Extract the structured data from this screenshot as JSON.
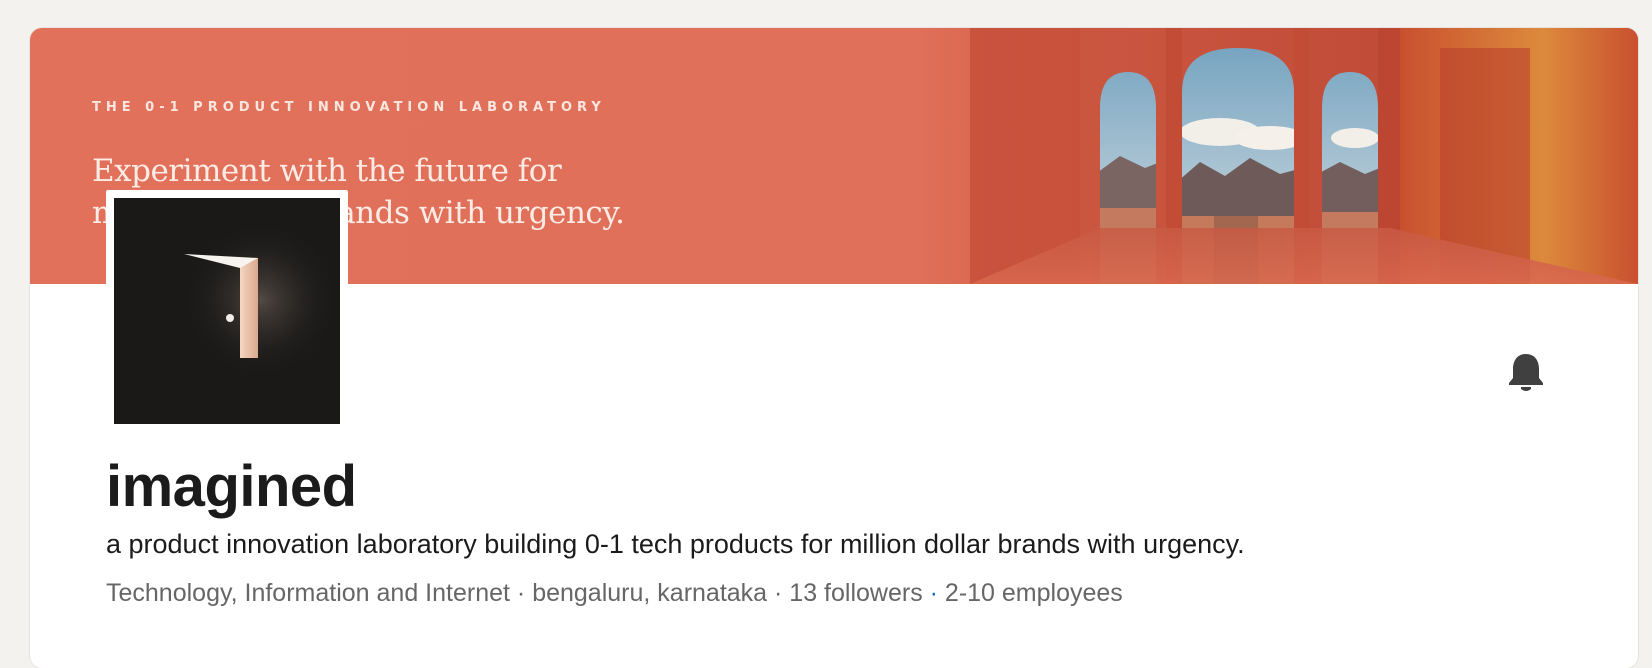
{
  "banner": {
    "tagline": "THE 0-1 PRODUCT INNOVATION LABORATORY",
    "headline_line1": "Experiment with the future for",
    "headline_line2": "million dollar brands with urgency."
  },
  "company": {
    "name": "imagined",
    "tagline": "a product innovation laboratory building 0-1 tech products for million dollar brands with urgency.",
    "industry": "Technology, Information and Internet",
    "location": "bengaluru, karnataka",
    "followers": "13 followers",
    "employees": "2-10 employees",
    "separator": " · "
  },
  "icons": {
    "notification": "bell-icon",
    "logo": "door-logo"
  },
  "colors": {
    "banner": "#e2715b",
    "logo_bg": "#1a1918",
    "link_blue": "#0a66c2",
    "text_primary": "#1b1b1b",
    "text_secondary": "#666666"
  }
}
